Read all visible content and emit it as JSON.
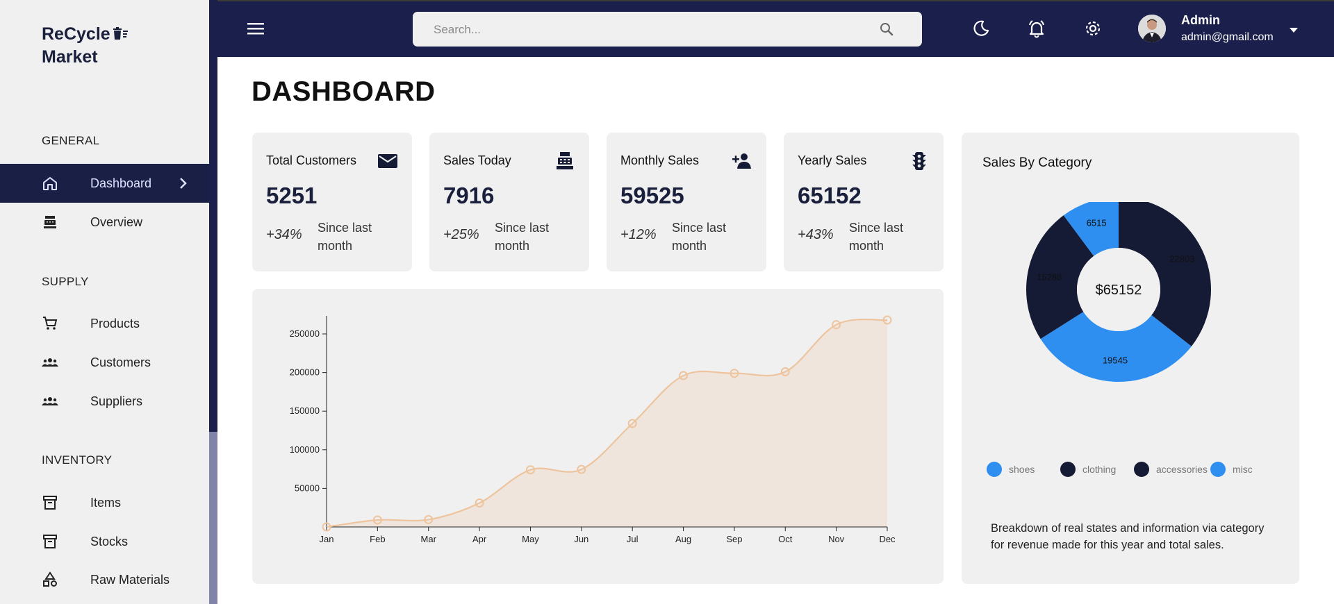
{
  "brand": {
    "line1": "ReCycle",
    "line2": "Market"
  },
  "sidebar": {
    "sections": [
      {
        "title": "GENERAL",
        "items": [
          {
            "label": "Dashboard",
            "icon": "home-icon",
            "active": true
          },
          {
            "label": "Overview",
            "icon": "register-icon"
          }
        ]
      },
      {
        "title": "SUPPLY",
        "items": [
          {
            "label": "Products",
            "icon": "cart-icon"
          },
          {
            "label": "Customers",
            "icon": "people-icon"
          },
          {
            "label": "Suppliers",
            "icon": "people-icon"
          }
        ]
      },
      {
        "title": "INVENTORY",
        "items": [
          {
            "label": "Items",
            "icon": "archive-icon"
          },
          {
            "label": "Stocks",
            "icon": "archive-icon"
          },
          {
            "label": "Raw Materials",
            "icon": "shapes-icon"
          }
        ]
      }
    ]
  },
  "header": {
    "search_placeholder": "Search...",
    "user": {
      "name": "Admin",
      "email": "admin@gmail.com"
    }
  },
  "page": {
    "title": "DASHBOARD"
  },
  "cards": [
    {
      "title": "Total Customers",
      "value": "5251",
      "change": "+34%",
      "since": "Since last month",
      "icon": "mail-icon"
    },
    {
      "title": "Sales Today",
      "value": "7916",
      "change": "+25%",
      "since": "Since last month",
      "icon": "register-icon"
    },
    {
      "title": "Monthly Sales",
      "value": "59525",
      "change": "+12%",
      "since": "Since last month",
      "icon": "person-add-icon"
    },
    {
      "title": "Yearly Sales",
      "value": "65152",
      "change": "+43%",
      "since": "Since last month",
      "icon": "traffic-light-icon"
    }
  ],
  "category": {
    "title": "Sales By Category",
    "center_label": "$65152",
    "description": "Breakdown of real states and information via category for revenue made for this year and total sales.",
    "legend": [
      {
        "label": "shoes",
        "color": "#2e8ff0"
      },
      {
        "label": "clothing",
        "color": "#151a35"
      },
      {
        "label": "accessories",
        "color": "#151a35"
      },
      {
        "label": "misc",
        "color": "#2e8ff0"
      }
    ]
  },
  "chart_data": [
    {
      "type": "area",
      "categories": [
        "Jan",
        "Feb",
        "Mar",
        "Apr",
        "May",
        "Jun",
        "Jul",
        "Aug",
        "Sep",
        "Oct",
        "Nov",
        "Dec"
      ],
      "values": [
        0,
        9000,
        9500,
        31000,
        74000,
        74500,
        134000,
        196000,
        199000,
        201000,
        262000,
        268000
      ],
      "yticks": [
        50000,
        100000,
        150000,
        200000,
        250000
      ],
      "ylim": [
        0,
        268000
      ],
      "title": "",
      "xlabel": "",
      "ylabel": "",
      "line_color": "#eec49e",
      "fill_color": "#efe5dc"
    },
    {
      "type": "pie",
      "labels": [
        "shoes",
        "clothing",
        "accessories",
        "misc"
      ],
      "values": [
        6515,
        22803,
        19545,
        15288
      ],
      "colors": [
        "#2e8ff0",
        "#151a35",
        "#2e8ff0",
        "#151a35"
      ]
    }
  ]
}
